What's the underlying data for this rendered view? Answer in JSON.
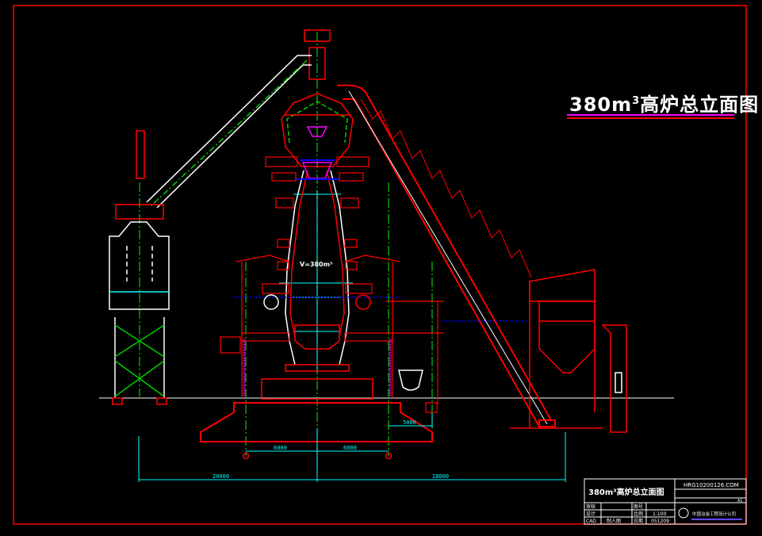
{
  "drawing": {
    "title": "380m³高炉总立面图",
    "title_main": "380m",
    "title_sup": "3",
    "title_rest": "高炉总立面图",
    "volume_label": "V=380m³",
    "colors": {
      "border": "#ff0000",
      "structure": "#ff0000",
      "outline": "#ffffff",
      "centerline": "#00cc00",
      "dimension": "#00ffff",
      "piping": "#0000ff",
      "highlight": "#ff00ff"
    }
  },
  "dimensions": {
    "d_left_total": "20000",
    "d_right_total": "28000",
    "d_left_found": "6000",
    "d_right_found": "6000",
    "d_right_edge": "5000"
  },
  "title_block": {
    "drawing_name": "380m³高炉总立面图",
    "code": "HRG10200126.COM",
    "sheet": "A1",
    "rows": [
      {
        "label": "审核",
        "value": "",
        "label2": "图号",
        "value2": ""
      },
      {
        "label": "设计",
        "value": "",
        "label2": "比例",
        "value2": "1:100"
      },
      {
        "label": "CAD",
        "value": "制人图",
        "label2": "日期",
        "value2": "051209"
      }
    ],
    "company": "中国冶金工程设计公司"
  }
}
